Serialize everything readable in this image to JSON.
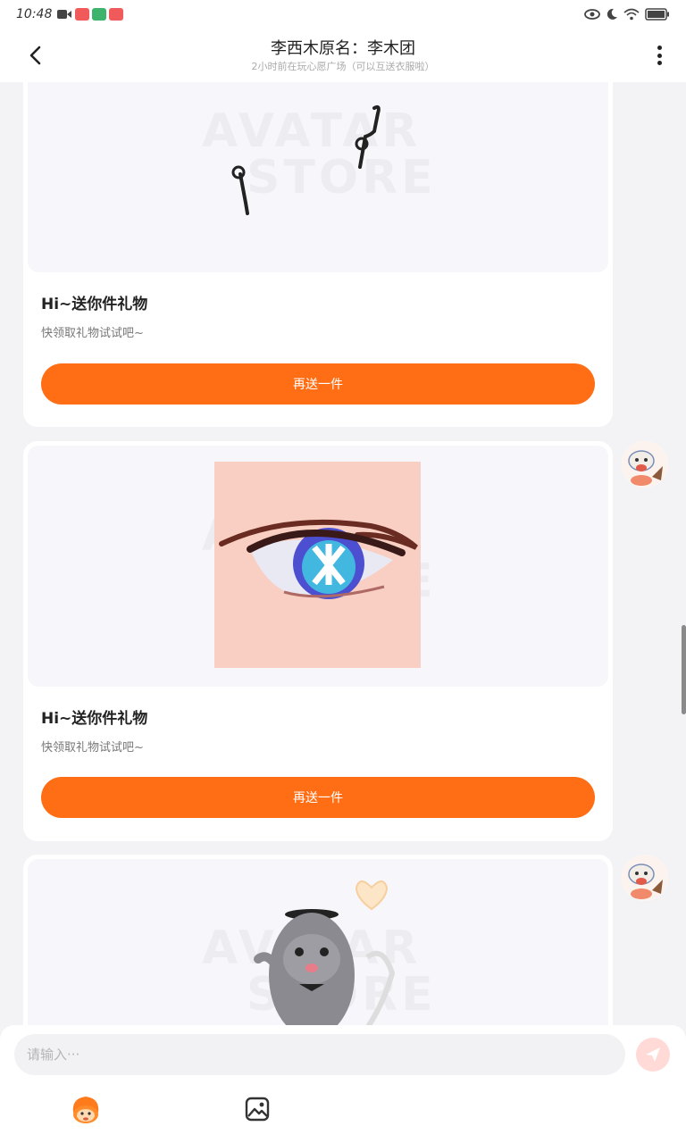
{
  "status_bar": {
    "time": "10:48",
    "icons": [
      "video-icon",
      "app-badge-icon",
      "panda-app-icon",
      "app-badge-icon",
      "eye-icon",
      "moon-icon",
      "wifi-icon",
      "battery-icon"
    ]
  },
  "header": {
    "title": "李西木原名：李木团",
    "subtitle": "2小时前在玩心愿广场（可以互送衣服啦）"
  },
  "messages": [
    {
      "gift_image": "eye-accessory-sketch",
      "title": "Hi~送你件礼物",
      "desc": "快领取礼物试试吧~",
      "button_label": "再送一件"
    },
    {
      "gift_image": "anime-eye",
      "title": "Hi~送你件礼物",
      "desc": "快领取礼物试试吧~",
      "button_label": "再送一件"
    },
    {
      "gift_image": "hamster-with-hat"
    }
  ],
  "watermark": {
    "line1": "AVATAR",
    "line2": "STORE"
  },
  "composer": {
    "placeholder": "请输入···"
  },
  "colors": {
    "accent": "#ff6e14",
    "send_bg": "#ffdad6",
    "background": "#f3f3f6"
  }
}
